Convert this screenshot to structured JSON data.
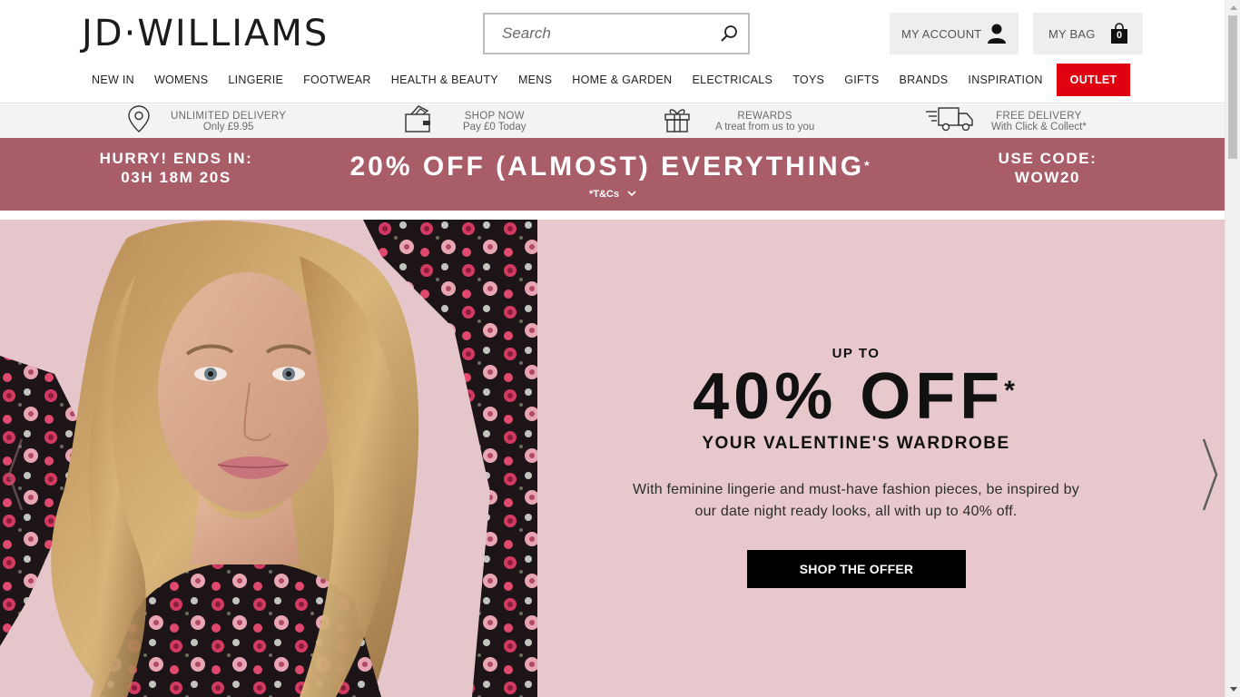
{
  "header": {
    "logo": "JD·WILLIAMS",
    "search_placeholder": "Search",
    "account_label": "MY ACCOUNT",
    "bag_label": "MY BAG",
    "bag_count": "0"
  },
  "nav": {
    "items": [
      "NEW IN",
      "WOMENS",
      "LINGERIE",
      "FOOTWEAR",
      "HEALTH & BEAUTY",
      "MENS",
      "HOME & GARDEN",
      "ELECTRICALS",
      "TOYS",
      "GIFTS",
      "BRANDS",
      "INSPIRATION"
    ],
    "outlet": "OUTLET",
    "outlet_color": "#e1000f"
  },
  "usp": [
    {
      "icon": "location-pin-icon",
      "line1": "UNLIMITED DELIVERY",
      "line2": "Only £9.95"
    },
    {
      "icon": "card-wallet-icon",
      "line1": "SHOP NOW",
      "line2": "Pay £0 Today"
    },
    {
      "icon": "gift-icon",
      "line1": "REWARDS",
      "line2": "A treat from us to you"
    },
    {
      "icon": "delivery-truck-icon",
      "line1": "FREE DELIVERY",
      "line2": "With Click & Collect*"
    }
  ],
  "promo": {
    "timer_line1": "HURRY! ENDS IN:",
    "timer_line2": "03H 18M 20S",
    "headline": "20% OFF (ALMOST) EVERYTHING",
    "headline_mark": "*",
    "tcs": "*T&Cs",
    "code_line1": "USE CODE:",
    "code_line2": "WOW20",
    "color": "#a85d69"
  },
  "hero": {
    "upto": "UP TO",
    "big": "40% OFF",
    "big_mark": "*",
    "sub": "YOUR VALENTINE'S WARDROBE",
    "desc_line1": "With feminine lingerie and must-have fashion pieces, be inspired by",
    "desc_line2": "our date night ready looks, all with up to 40% off.",
    "cta": "SHOP THE OFFER",
    "bg": "#e7c8cc"
  }
}
